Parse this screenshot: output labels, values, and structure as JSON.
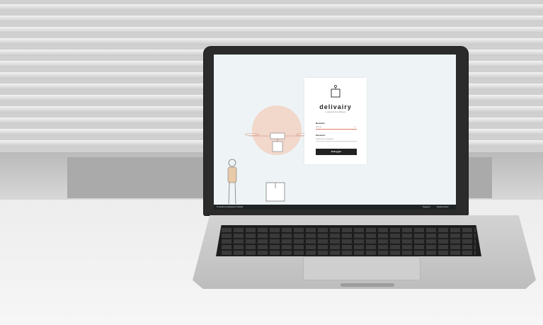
{
  "brand": {
    "name": "delivairy",
    "tagline": "a new kind of delivery"
  },
  "login": {
    "username_label": "Benutzer",
    "username_value": "admin",
    "password_label": "Passwort",
    "password_placeholder": "Passwort eingeben",
    "submit_label": "Einloggen"
  },
  "footer": {
    "left_text": "Produkt-Konfigurator Mobile",
    "link_1": "Support",
    "link_2": "Datenschutz"
  },
  "colors": {
    "accent": "#e37b6b",
    "button": "#222222",
    "screen_bg": "#eef4f6"
  }
}
